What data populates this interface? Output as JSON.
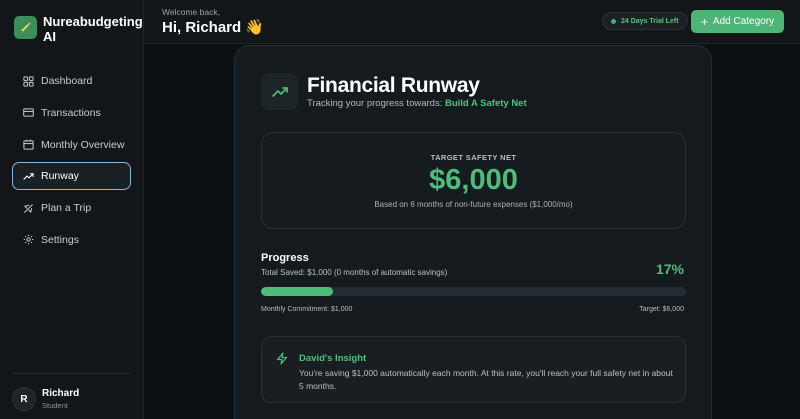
{
  "brand": {
    "name": "Nureabudgeting AI",
    "logo_icon": "pencil-icon"
  },
  "sidebar": {
    "items": [
      {
        "label": "Dashboard",
        "icon": "grid-icon",
        "active": false
      },
      {
        "label": "Transactions",
        "icon": "card-icon",
        "active": false
      },
      {
        "label": "Monthly Overview",
        "icon": "calendar-icon",
        "active": false
      },
      {
        "label": "Runway",
        "icon": "trending-up-icon",
        "active": true
      },
      {
        "label": "Plan a Trip",
        "icon": "plane-icon",
        "active": false
      },
      {
        "label": "Settings",
        "icon": "gear-icon",
        "active": false
      }
    ]
  },
  "user": {
    "initial": "R",
    "name": "Richard",
    "role": "Student"
  },
  "header": {
    "welcome": "Welcome back,",
    "greeting": "Hi, Richard 👋",
    "trial_badge": "24 Days Trial Left",
    "add_button": "Add Category"
  },
  "runway": {
    "title": "Financial Runway",
    "subtitle_prefix": "Tracking your progress towards:",
    "goal": "Build A Safety Net",
    "target_label": "TARGET SAFETY NET",
    "target_amount": "$6,000",
    "target_note": "Based on 6 months of non-future expenses ($1,000/mo)"
  },
  "progress": {
    "title": "Progress",
    "saved_text": "Total Saved: $1,000 (0 months of automatic savings)",
    "percent_label": "17%",
    "fill_fraction": 0.17,
    "commitment": "Monthly Commitment: $1,000",
    "target": "Target: $6,000"
  },
  "insight": {
    "title": "David's Insight",
    "text": "You're saving $1,000 automatically each month. At this rate, you'll reach your full safety net in about 5 months."
  },
  "colors": {
    "accent": "#4dbe79",
    "active_border": "#8ab4d6",
    "background": "#0d1013"
  }
}
